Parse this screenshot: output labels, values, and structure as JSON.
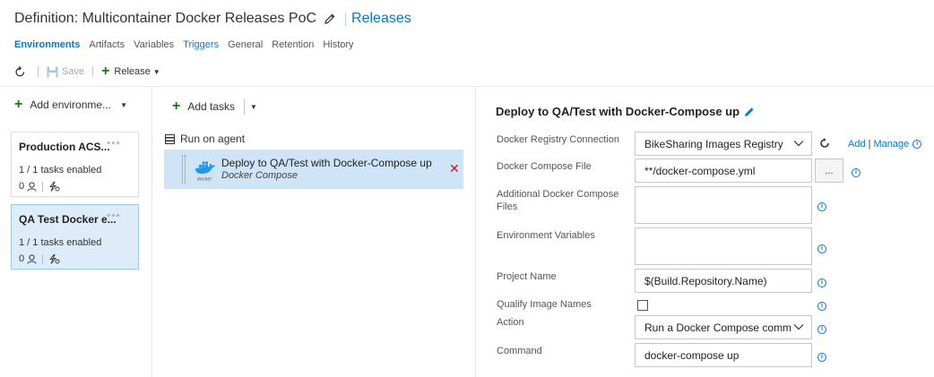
{
  "header": {
    "title": "Definition: Multicontainer Docker Releases PoC",
    "link": "Releases"
  },
  "tabs": [
    {
      "label": "Environments"
    },
    {
      "label": "Artifacts"
    },
    {
      "label": "Variables"
    },
    {
      "label": "Triggers"
    },
    {
      "label": "General"
    },
    {
      "label": "Retention"
    },
    {
      "label": "History"
    }
  ],
  "toolbar": {
    "save_label": "Save",
    "release_label": "Release"
  },
  "environments": {
    "add_label": "Add environme...",
    "cards": [
      {
        "name": "Production ACS...",
        "more": "***",
        "tasks": "1 / 1 tasks enabled",
        "approvers": "0"
      },
      {
        "name": "QA Test Docker e...",
        "more": "***",
        "tasks": "1 / 1 tasks enabled",
        "approvers": "0"
      }
    ]
  },
  "tasks": {
    "add_label": "Add tasks",
    "phase_label": "Run on agent",
    "items": [
      {
        "name": "Deploy to QA/Test with Docker-Compose up",
        "type": "Docker Compose",
        "logo_text": "docker"
      }
    ]
  },
  "details": {
    "title": "Deploy to QA/Test with Docker-Compose up",
    "fields": {
      "registry": {
        "label": "Docker Registry Connection",
        "value": "BikeSharing Images Registry"
      },
      "compose_file": {
        "label": "Docker Compose File",
        "value": "**/docker-compose.yml"
      },
      "additional_files": {
        "label": "Additional Docker Compose Files",
        "value": ""
      },
      "env_vars": {
        "label": "Environment Variables",
        "value": ""
      },
      "project_name": {
        "label": "Project Name",
        "value": "$(Build.Repository.Name)"
      },
      "qualify": {
        "label": "Qualify Image Names",
        "checked": false
      },
      "action": {
        "label": "Action",
        "value": "Run a Docker Compose comm"
      },
      "command": {
        "label": "Command",
        "value": "docker-compose up"
      }
    },
    "add_link": "Add",
    "manage_link": "Manage",
    "browse_label": "...",
    "info_glyph": "i"
  },
  "colors": {
    "accent": "#0078d7",
    "add_green": "#107c10",
    "remove_red": "#c50f1f",
    "selected_bg": "#deecf9",
    "task_bg": "#cfe4f6"
  }
}
